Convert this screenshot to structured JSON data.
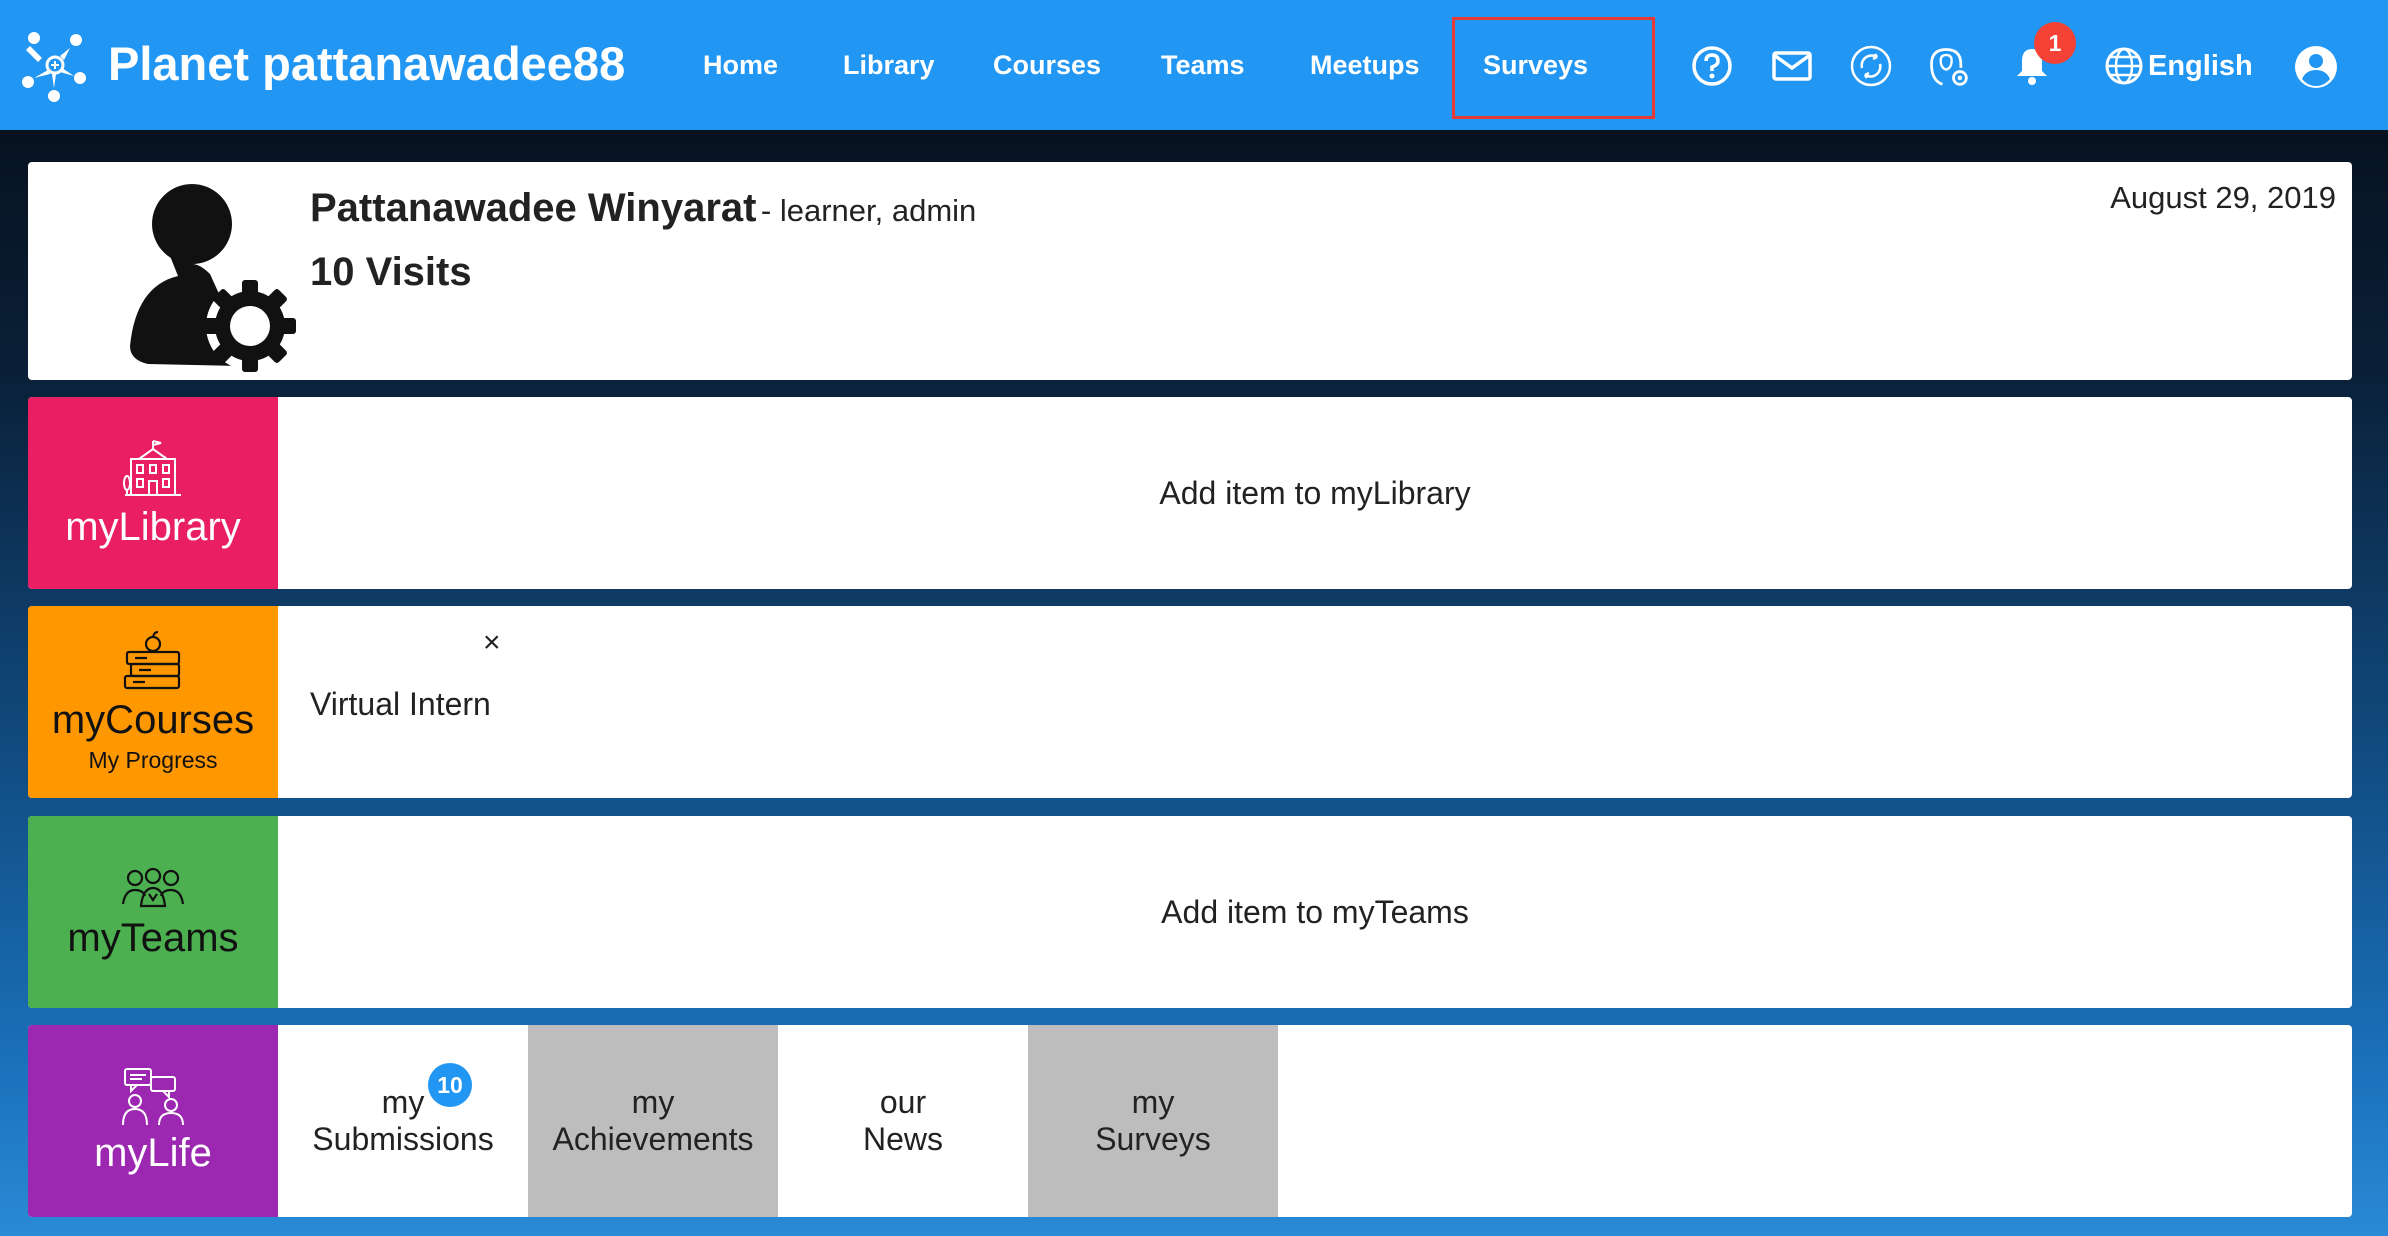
{
  "header": {
    "app_title": "Planet pattanawadee88",
    "nav": [
      "Home",
      "Library",
      "Courses",
      "Teams",
      "Meetups",
      "Surveys"
    ],
    "notification_count": "1",
    "language": "English",
    "icons": [
      "help-icon",
      "mail-icon",
      "sync-icon",
      "manager-settings-icon",
      "bell-icon",
      "globe-icon",
      "account-icon"
    ]
  },
  "profile": {
    "name": "Pattanawadee Winyarat",
    "roles": "- learner, admin",
    "visits": "10 Visits",
    "date": "August 29, 2019"
  },
  "library": {
    "label": "myLibrary",
    "empty_text": "Add item to myLibrary",
    "color": "#e91e63"
  },
  "courses": {
    "label": "myCourses",
    "sublabel": "My Progress",
    "item": "Virtual Intern",
    "remove_symbol": "×",
    "color": "#ff9800"
  },
  "teams": {
    "label": "myTeams",
    "empty_text": "Add item to myTeams",
    "color": "#4caf50"
  },
  "life": {
    "label": "myLife",
    "color": "#9c27b0",
    "submissions_badge": "10",
    "tiles": [
      {
        "line1": "my",
        "line2": "Submissions"
      },
      {
        "line1": "my",
        "line2": "Achievements"
      },
      {
        "line1": "our",
        "line2": "News"
      },
      {
        "line1": "my",
        "line2": "Surveys"
      }
    ]
  }
}
